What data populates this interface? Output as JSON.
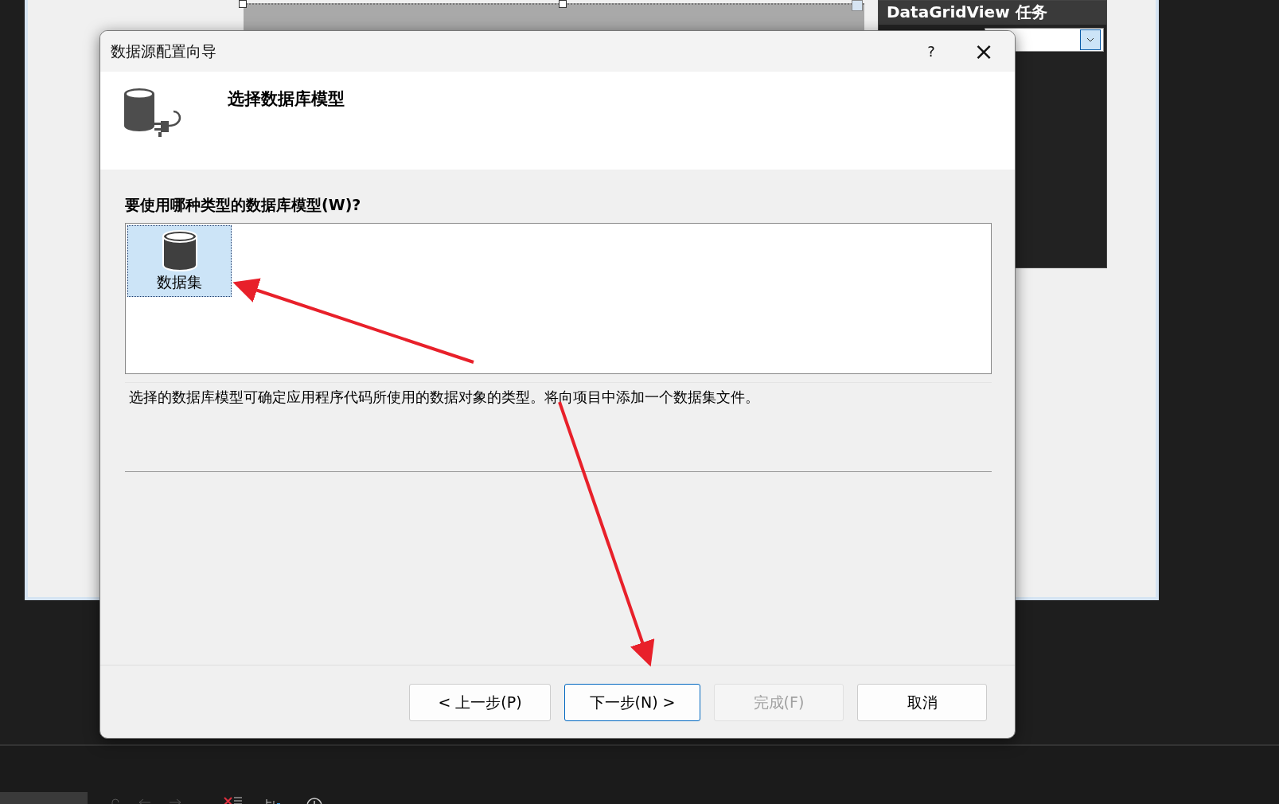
{
  "designer": {
    "tasks_panel": {
      "title": "DataGridView 任务"
    }
  },
  "dialog": {
    "title": "数据源配置向导",
    "help": "?",
    "close": "×",
    "header": {
      "title": "选择数据库模型"
    },
    "question": "要使用哪种类型的数据库模型(W)?",
    "models": [
      {
        "label": "数据集",
        "selected": true
      }
    ],
    "description": "选择的数据库模型可确定应用程序代码所使用的数据对象的类型。将向项目中添加一个数据集文件。",
    "buttons": [
      {
        "label": "< 上一步(P)",
        "kind": "normal",
        "disabled": false
      },
      {
        "label": "下一步(N) >",
        "kind": "default",
        "disabled": false
      },
      {
        "label": "完成(F)",
        "kind": "normal",
        "disabled": true
      },
      {
        "label": "取消",
        "kind": "normal",
        "disabled": false
      }
    ]
  }
}
